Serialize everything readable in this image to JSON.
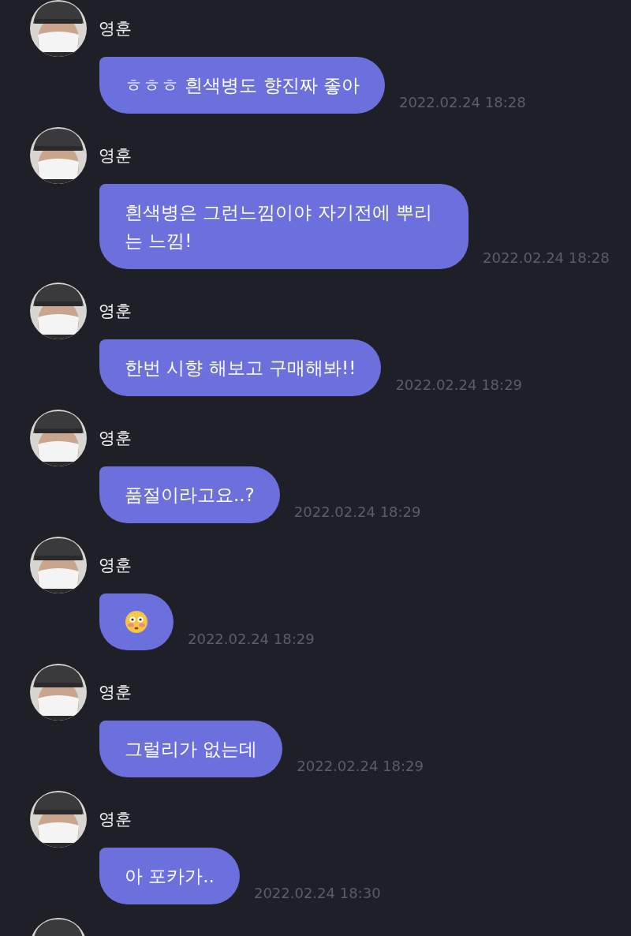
{
  "messages": [
    {
      "sender": "영훈",
      "kind": "text",
      "text": "ㅎㅎㅎ 흰색병도 향진짜 좋아",
      "time": "2022.02.24 18:28"
    },
    {
      "sender": "영훈",
      "kind": "text",
      "text": "흰색병은 그런느낌이야 자기전에 뿌리는 느낌!",
      "time": "2022.02.24 18:28"
    },
    {
      "sender": "영훈",
      "kind": "text",
      "text": "한번 시향 해보고 구매해봐!!",
      "time": "2022.02.24 18:29"
    },
    {
      "sender": "영훈",
      "kind": "text",
      "text": "품절이라고요..?",
      "time": "2022.02.24 18:29"
    },
    {
      "sender": "영훈",
      "kind": "emoji",
      "time": "2022.02.24 18:29"
    },
    {
      "sender": "영훈",
      "kind": "text",
      "text": "그럴리가 없는데",
      "time": "2022.02.24 18:29"
    },
    {
      "sender": "영훈",
      "kind": "text",
      "text": "아 포카가..",
      "time": "2022.02.24 18:30"
    }
  ]
}
